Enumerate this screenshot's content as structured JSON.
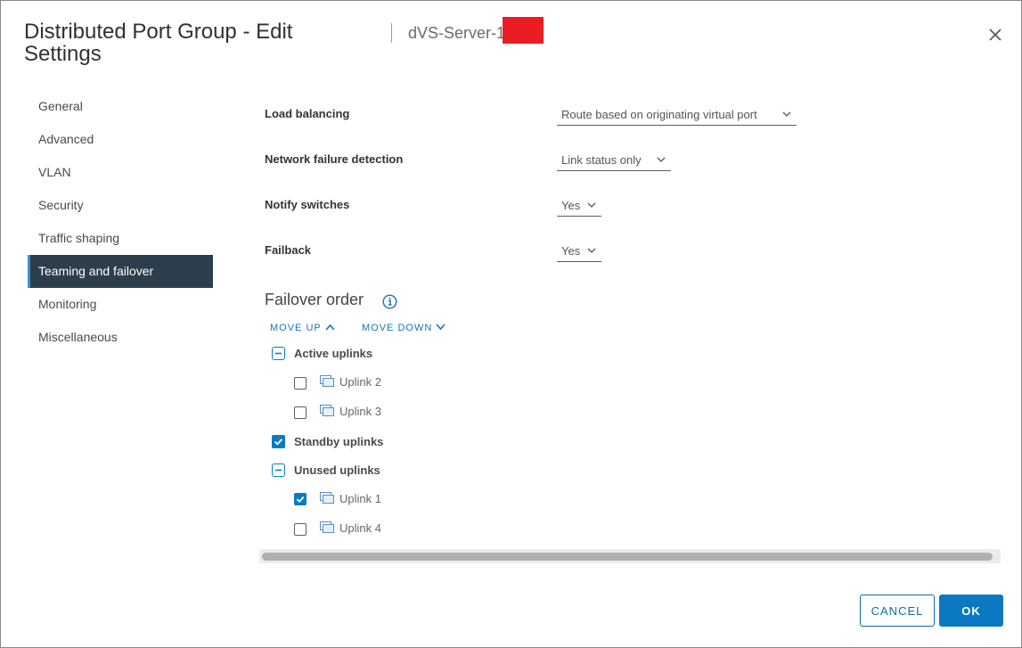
{
  "dialog": {
    "title": "Distributed Port Group - Edit Settings",
    "subtitle": "dVS-Server-1"
  },
  "sidebar": {
    "items": [
      {
        "label": "General"
      },
      {
        "label": "Advanced"
      },
      {
        "label": "VLAN"
      },
      {
        "label": "Security"
      },
      {
        "label": "Traffic shaping"
      },
      {
        "label": "Teaming and failover",
        "active": true
      },
      {
        "label": "Monitoring"
      },
      {
        "label": "Miscellaneous"
      }
    ]
  },
  "form": {
    "load_balancing": {
      "label": "Load balancing",
      "value": "Route based on originating virtual port"
    },
    "network_failure_detection": {
      "label": "Network failure detection",
      "value": "Link status only"
    },
    "notify_switches": {
      "label": "Notify switches",
      "value": "Yes"
    },
    "failback": {
      "label": "Failback",
      "value": "Yes"
    }
  },
  "failover": {
    "title": "Failover order",
    "move_up": "MOVE UP",
    "move_down": "MOVE DOWN",
    "groups": {
      "active": {
        "label": "Active uplinks",
        "state": "partial"
      },
      "standby": {
        "label": "Standby uplinks",
        "state": "checked"
      },
      "unused": {
        "label": "Unused uplinks",
        "state": "partial"
      }
    },
    "uplinks": {
      "uplink2": {
        "label": "Uplink 2",
        "checked": false
      },
      "uplink3": {
        "label": "Uplink 3",
        "checked": false
      },
      "uplink1": {
        "label": "Uplink 1",
        "checked": true
      },
      "uplink4": {
        "label": "Uplink 4",
        "checked": false
      }
    }
  },
  "footer": {
    "cancel": "CANCEL",
    "ok": "OK"
  },
  "colors": {
    "accent": "#0a79c1",
    "active_nav_bg": "#2c3e4c",
    "redaction": "#ec1c24"
  },
  "icons": {
    "close": "close-icon",
    "info": "info-icon",
    "chevron_up": "chevron-up-icon",
    "chevron_down": "chevron-down-icon",
    "uplink": "uplink-icon"
  }
}
